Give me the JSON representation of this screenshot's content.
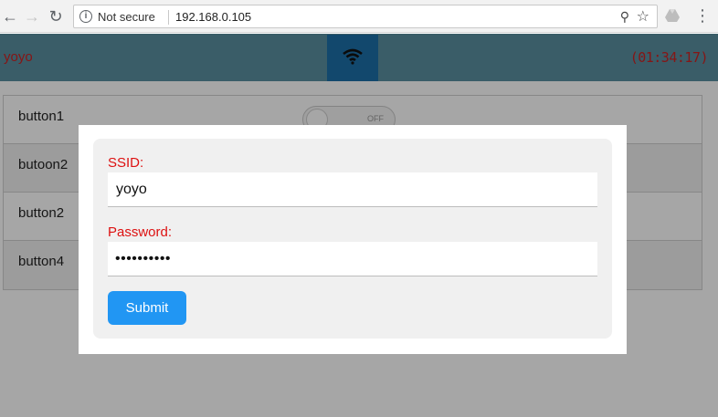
{
  "browser": {
    "security_label": "Not secure",
    "url": "192.168.0.105",
    "icons": {
      "back": "arrow-left-icon",
      "forward": "arrow-right-icon",
      "reload": "reload-icon",
      "info": "info-icon",
      "key": "key-icon",
      "star": "star-icon",
      "extension": "drive-icon",
      "menu": "kebab-menu-icon"
    }
  },
  "header": {
    "title": "yoyo",
    "clock": "(01:34:17)",
    "wifi_icon": "wifi-icon",
    "colors": {
      "bar": "#5a8fa0",
      "wifi_button": "#1d6fa8",
      "text": "#cc2222"
    }
  },
  "buttons": [
    {
      "label": "button1",
      "toggle": "OFF"
    },
    {
      "label": "butoon2"
    },
    {
      "label": "button2"
    },
    {
      "label": "button4"
    }
  ],
  "modal": {
    "close_label": "×",
    "ssid_label": "SSID:",
    "ssid_value": "yoyo",
    "password_label": "Password:",
    "password_masked": "••••••••••",
    "submit_label": "Submit",
    "colors": {
      "label": "#dd1111",
      "submit": "#2196f3"
    }
  }
}
